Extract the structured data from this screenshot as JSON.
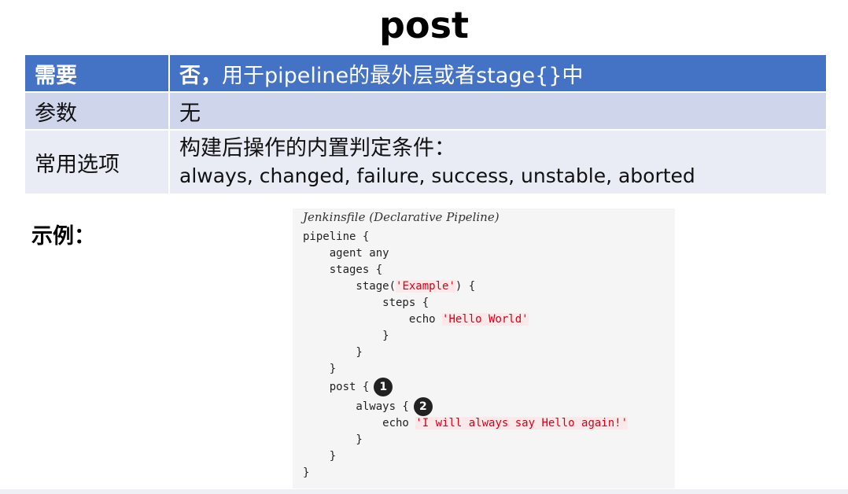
{
  "slide": {
    "title": "post"
  },
  "spec_table": {
    "rows": [
      {
        "label": "需要",
        "value_strong": "否，",
        "value": "用于pipeline的最外层或者stage{}中"
      },
      {
        "label": "参数",
        "value": "无"
      },
      {
        "label": "常用选项",
        "value": "构建后操作的内置判定条件：",
        "value_line2": "always, changed, failure, success, unstable, aborted"
      }
    ]
  },
  "example": {
    "label": "示例：",
    "caption": "Jenkinsfile (Declarative Pipeline)",
    "lines": [
      {
        "text": "pipeline {"
      },
      {
        "text": "    agent any"
      },
      {
        "text": "    stages {"
      },
      {
        "pre": "        stage(",
        "str": "'Example'",
        "post": ") {"
      },
      {
        "text": "            steps {"
      },
      {
        "pre": "                echo ",
        "str": "'Hello World'"
      },
      {
        "text": "            }"
      },
      {
        "text": "        }"
      },
      {
        "text": "    }"
      },
      {
        "pre": "    post {",
        "badge": "1"
      },
      {
        "pre": "        always {",
        "badge": "2"
      },
      {
        "pre": "            echo ",
        "str": "'I will always say Hello again!'"
      },
      {
        "text": "        }"
      },
      {
        "text": "    }"
      },
      {
        "text": "}"
      }
    ]
  },
  "colors": {
    "header_blue": "#4472c4",
    "row_band_1": "#cfd5ea",
    "row_band_2": "#e9ebf5",
    "code_background": "#f5f5f5",
    "string_red": "#d0021b"
  }
}
